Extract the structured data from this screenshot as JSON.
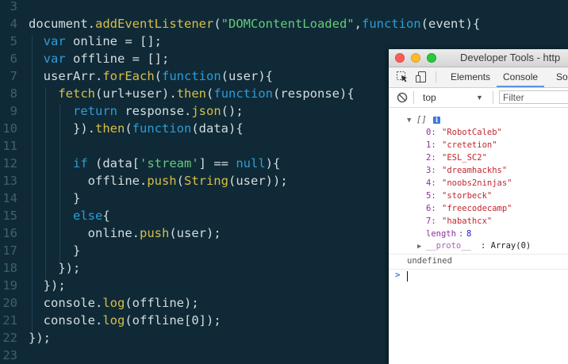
{
  "editor": {
    "lines": [
      {
        "num": "3",
        "parts": []
      },
      {
        "num": "4",
        "parts": [
          [
            "t-plain",
            "document."
          ],
          [
            "t-fn",
            "addEventListener"
          ],
          [
            "t-par",
            "("
          ],
          [
            "t-str",
            "\"DOMContentLoaded\""
          ],
          [
            "t-plain",
            ","
          ],
          [
            "t-kw",
            "function"
          ],
          [
            "t-par",
            "("
          ],
          [
            "t-plain",
            "event"
          ],
          [
            "t-par",
            "){"
          ]
        ]
      },
      {
        "num": "5",
        "parts": [
          [
            "t-plain",
            "  "
          ],
          [
            "t-kw",
            "var"
          ],
          [
            "t-plain",
            " online = [];"
          ]
        ]
      },
      {
        "num": "6",
        "parts": [
          [
            "t-plain",
            "  "
          ],
          [
            "t-kw",
            "var"
          ],
          [
            "t-plain",
            " offline = [];"
          ]
        ]
      },
      {
        "num": "7",
        "parts": [
          [
            "t-plain",
            "  userArr."
          ],
          [
            "t-fn",
            "forEach"
          ],
          [
            "t-par",
            "("
          ],
          [
            "t-kw",
            "function"
          ],
          [
            "t-par",
            "("
          ],
          [
            "t-plain",
            "user"
          ],
          [
            "t-par",
            "){"
          ]
        ]
      },
      {
        "num": "8",
        "parts": [
          [
            "t-plain",
            "    "
          ],
          [
            "t-fn",
            "fetch"
          ],
          [
            "t-par",
            "("
          ],
          [
            "t-plain",
            "url+user"
          ],
          [
            "t-par",
            ")"
          ],
          [
            "t-plain",
            "."
          ],
          [
            "t-fn",
            "then"
          ],
          [
            "t-par",
            "("
          ],
          [
            "t-kw",
            "function"
          ],
          [
            "t-par",
            "("
          ],
          [
            "t-plain",
            "response"
          ],
          [
            "t-par",
            "){"
          ]
        ]
      },
      {
        "num": "9",
        "parts": [
          [
            "t-plain",
            "      "
          ],
          [
            "t-kw",
            "return"
          ],
          [
            "t-plain",
            " response."
          ],
          [
            "t-fn",
            "json"
          ],
          [
            "t-par",
            "();"
          ]
        ]
      },
      {
        "num": "10",
        "parts": [
          [
            "t-plain",
            "      })."
          ],
          [
            "t-fn",
            "then"
          ],
          [
            "t-par",
            "("
          ],
          [
            "t-kw",
            "function"
          ],
          [
            "t-par",
            "("
          ],
          [
            "t-plain",
            "data"
          ],
          [
            "t-par",
            "){"
          ]
        ]
      },
      {
        "num": "11",
        "parts": []
      },
      {
        "num": "12",
        "parts": [
          [
            "t-plain",
            "      "
          ],
          [
            "t-kw",
            "if"
          ],
          [
            "t-plain",
            " (data["
          ],
          [
            "t-str",
            "'stream'"
          ],
          [
            "t-plain",
            "] == "
          ],
          [
            "t-kw",
            "null"
          ],
          [
            "t-plain",
            "){"
          ]
        ]
      },
      {
        "num": "13",
        "parts": [
          [
            "t-plain",
            "        offline."
          ],
          [
            "t-fn",
            "push"
          ],
          [
            "t-par",
            "("
          ],
          [
            "t-fn",
            "String"
          ],
          [
            "t-par",
            "("
          ],
          [
            "t-plain",
            "user"
          ],
          [
            "t-par",
            "));"
          ]
        ]
      },
      {
        "num": "14",
        "parts": [
          [
            "t-plain",
            "      }"
          ]
        ]
      },
      {
        "num": "15",
        "parts": [
          [
            "t-plain",
            "      "
          ],
          [
            "t-kw",
            "else"
          ],
          [
            "t-plain",
            "{"
          ]
        ]
      },
      {
        "num": "16",
        "parts": [
          [
            "t-plain",
            "        online."
          ],
          [
            "t-fn",
            "push"
          ],
          [
            "t-par",
            "("
          ],
          [
            "t-plain",
            "user"
          ],
          [
            "t-par",
            ");"
          ]
        ]
      },
      {
        "num": "17",
        "parts": [
          [
            "t-plain",
            "      }"
          ]
        ]
      },
      {
        "num": "18",
        "parts": [
          [
            "t-plain",
            "    });"
          ]
        ]
      },
      {
        "num": "19",
        "parts": [
          [
            "t-plain",
            "  });"
          ]
        ]
      },
      {
        "num": "20",
        "parts": [
          [
            "t-plain",
            "  console."
          ],
          [
            "t-fn",
            "log"
          ],
          [
            "t-par",
            "("
          ],
          [
            "t-plain",
            "offline"
          ],
          [
            "t-par",
            ");"
          ]
        ]
      },
      {
        "num": "21",
        "parts": [
          [
            "t-plain",
            "  console."
          ],
          [
            "t-fn",
            "log"
          ],
          [
            "t-par",
            "("
          ],
          [
            "t-plain",
            "offline[0]"
          ],
          [
            "t-par",
            ");"
          ]
        ]
      },
      {
        "num": "22",
        "parts": [
          [
            "t-plain",
            "});"
          ]
        ]
      },
      {
        "num": "23",
        "parts": []
      }
    ]
  },
  "devtools": {
    "window_title": "Developer Tools - http",
    "tabs": [
      "Elements",
      "Console",
      "So"
    ],
    "active_tab": "Console",
    "context": "top",
    "filter_placeholder": "Filter",
    "console": {
      "array_header": "[]",
      "info_badge": "i",
      "items": [
        {
          "index": "0:",
          "value": "\"RobotCaleb\""
        },
        {
          "index": "1:",
          "value": "\"cretetion\""
        },
        {
          "index": "2:",
          "value": "\"ESL_SC2\""
        },
        {
          "index": "3:",
          "value": "\"dreamhackhs\""
        },
        {
          "index": "4:",
          "value": "\"noobs2ninjas\""
        },
        {
          "index": "5:",
          "value": "\"storbeck\""
        },
        {
          "index": "6:",
          "value": "\"freecodecamp\""
        },
        {
          "index": "7:",
          "value": "\"habathcx\""
        }
      ],
      "length_label": "length",
      "length_value": "8",
      "proto_label": "__proto__",
      "proto_value": ": Array(0)",
      "result": "undefined",
      "prompt": ">"
    }
  },
  "colors": {
    "editor_bg": "#0f2a36",
    "keyword": "#2f9bd6",
    "function": "#d8be4a",
    "string": "#67c97a",
    "console_string": "#c2272d",
    "console_index": "#8b2f9e"
  }
}
